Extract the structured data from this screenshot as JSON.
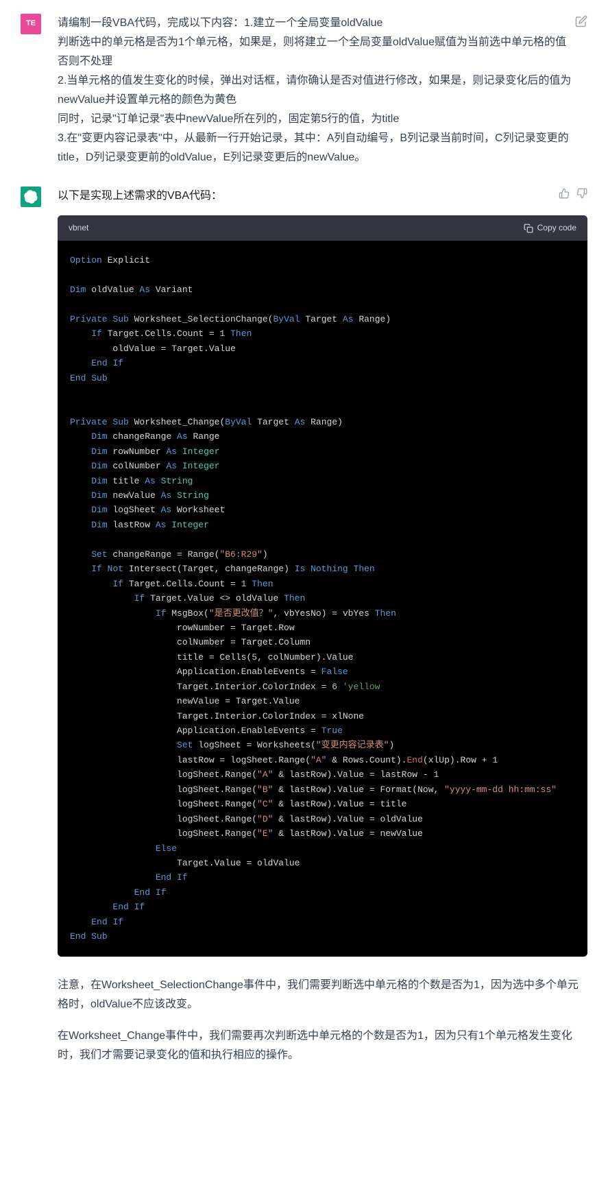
{
  "user": {
    "avatar": "TE",
    "lines": [
      "请编制一段VBA代码，完成以下内容：1.建立一个全局变量oldValue",
      "判断选中的单元格是否为1个单元格，如果是，则将建立一个全局变量oldValue赋值为当前选中单元格的值",
      "否则不处理",
      "2.当单元格的值发生变化的时候，弹出对话框，请你确认是否对值进行修改，如果是，则记录变化后的值为newValue并设置单元格的颜色为黄色",
      "同时，记录\"订单记录\"表中newValue所在列的，固定第5行的值，为title",
      "3.在\"变更内容记录表\"中，从最新一行开始记录，其中：A列自动编号，B列记录当前时间，C列记录变更的title，D列记录变更前的oldValue，E列记录变更后的newValue。"
    ]
  },
  "assistant": {
    "intro": "以下是实现上述需求的VBA代码：",
    "code_lang": "vbnet",
    "copy_label": "Copy code",
    "note1": "注意，在Worksheet_SelectionChange事件中，我们需要判断选中单元格的个数是否为1，因为选中多个单元格时，oldValue不应该改变。",
    "note2": "在Worksheet_Change事件中，我们需要再次判断选中单元格的个数是否为1，因为只有1个单元格发生变化时，我们才需要记录变化的值和执行相应的操作。"
  },
  "code": {
    "l1a": "Option",
    "l1b": " Explicit",
    "l2a": "Dim",
    "l2b": " oldValue ",
    "l2c": "As",
    "l2d": " Variant",
    "l3a": "Private",
    "l3b": "Sub",
    "l3c": " Worksheet_SelectionChange(",
    "l3d": "ByVal",
    "l3e": " Target ",
    "l3f": "As",
    "l3g": " Range)",
    "l4a": "If",
    "l4b": " Target.Cells.Count = ",
    "l4c": "1",
    "l4d": "Then",
    "l5": "        oldValue = Target.Value",
    "l6a": "End",
    "l6b": "If",
    "l7a": "End",
    "l7b": "Sub",
    "l8a": "Private",
    "l8b": "Sub",
    "l8c": " Worksheet_Change(",
    "l8d": "ByVal",
    "l8e": " Target ",
    "l8f": "As",
    "l8g": " Range)",
    "l9a": "Dim",
    "l9b": " changeRange ",
    "l9c": "As",
    "l9d": " Range",
    "l10a": "Dim",
    "l10b": " rowNumber ",
    "l10c": "As",
    "l10d": "Integer",
    "l11a": "Dim",
    "l11b": " colNumber ",
    "l11c": "As",
    "l11d": "Integer",
    "l12a": "Dim",
    "l12b": " title ",
    "l12c": "As",
    "l12d": "String",
    "l13a": "Dim",
    "l13b": " newValue ",
    "l13c": "As",
    "l13d": "String",
    "l14a": "Dim",
    "l14b": " logSheet ",
    "l14c": "As",
    "l14d": " Worksheet",
    "l15a": "Dim",
    "l15b": " lastRow ",
    "l15c": "As",
    "l15d": "Integer",
    "l16a": "Set",
    "l16b": " changeRange = Range(",
    "l16c": "\"B6:R29\"",
    "l16d": ")",
    "l17a": "If",
    "l17b": "Not",
    "l17c": " Intersect(Target, changeRange) ",
    "l17d": "Is",
    "l17e": "Nothing",
    "l17f": "Then",
    "l18a": "If",
    "l18b": " Target.Cells.Count = ",
    "l18c": "1",
    "l18d": "Then",
    "l19a": "If",
    "l19b": " Target.Value <> oldValue ",
    "l19c": "Then",
    "l20a": "If",
    "l20b": " MsgBox(",
    "l20c": "\"是否更改值？\"",
    "l20d": ", vbYesNo) = vbYes ",
    "l20e": "Then",
    "l21": "                    rowNumber = Target.Row",
    "l22": "                    colNumber = Target.Column",
    "l23a": "                    title = Cells(",
    "l23b": "5",
    "l23c": ", colNumber).Value",
    "l24a": "                    Application.EnableEvents = ",
    "l24b": "False",
    "l25a": "                    Target.Interior.ColorIndex = ",
    "l25b": "6",
    "l25c": " 'yellow",
    "l26": "                    newValue = Target.Value",
    "l27": "                    Target.Interior.ColorIndex = xlNone",
    "l28a": "                    Application.EnableEvents = ",
    "l28b": "True",
    "l29a": "Set",
    "l29b": " logSheet = Worksheets(",
    "l29c": "\"变更内容记录表\"",
    "l29d": ")",
    "l30a": "                    lastRow = logSheet.Range(",
    "l30b": "\"A\"",
    "l30c": " & Rows.Count).",
    "l30d": "End",
    "l30e": "(xlUp).Row + ",
    "l30f": "1",
    "l31a": "                    logSheet.Range(",
    "l31b": "\"A\"",
    "l31c": " & lastRow).Value = lastRow - ",
    "l31d": "1",
    "l32a": "                    logSheet.Range(",
    "l32b": "\"B\"",
    "l32c": " & lastRow).Value = Format(Now, ",
    "l32d": "\"yyyy-mm-dd hh:mm:ss\"",
    "l33a": "                    logSheet.Range(",
    "l33b": "\"C\"",
    "l33c": " & lastRow).Value = title",
    "l34a": "                    logSheet.Range(",
    "l34b": "\"D\"",
    "l34c": " & lastRow).Value = oldValue",
    "l35a": "                    logSheet.Range(",
    "l35b": "\"E\"",
    "l35c": " & lastRow).Value = newValue",
    "l36": "Else",
    "l37": "                    Target.Value = oldValue",
    "l38a": "End",
    "l38b": "If",
    "l39a": "End",
    "l39b": "If",
    "l40a": "End",
    "l40b": "If",
    "l41a": "End",
    "l41b": "If",
    "l42a": "End",
    "l42b": "Sub"
  }
}
